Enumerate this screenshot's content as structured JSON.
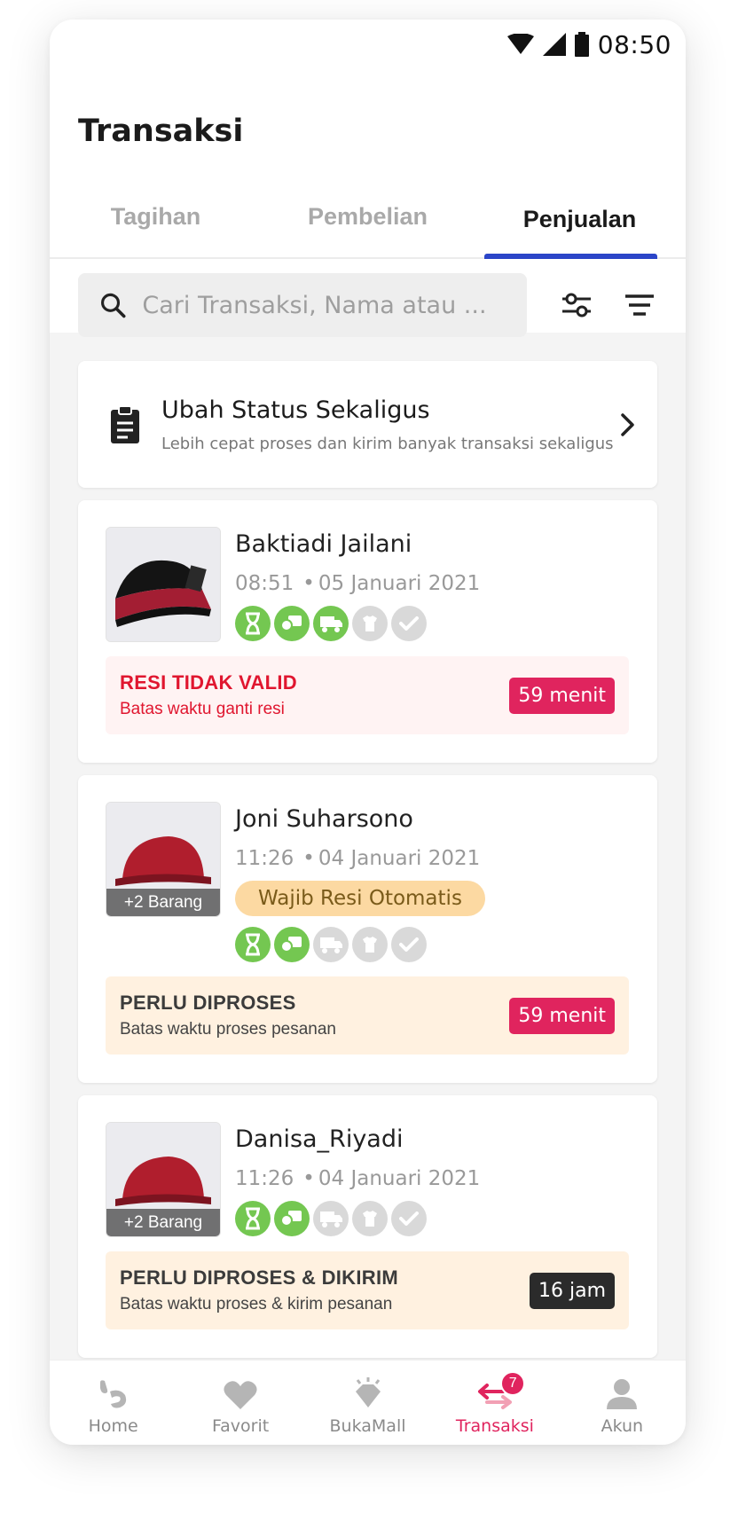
{
  "status_bar": {
    "time": "08:50"
  },
  "header": {
    "title": "Transaksi"
  },
  "tabs": [
    {
      "label": "Tagihan",
      "active": false
    },
    {
      "label": "Pembelian",
      "active": false
    },
    {
      "label": "Penjualan",
      "active": true
    }
  ],
  "search": {
    "placeholder": "Cari Transaksi, Nama atau ..."
  },
  "bulk_update": {
    "title": "Ubah Status Sekaligus",
    "subtitle": "Lebih cepat proses dan kirim banyak transaksi sekaligus"
  },
  "orders": [
    {
      "buyer": "Baktiadi Jailani",
      "time": "08:51",
      "date": "05 Januari 2021",
      "extra_items": "",
      "tag": "",
      "steps_done": 3,
      "alert": {
        "title": "RESI TIDAK VALID",
        "subtitle": "Batas waktu ganti resi",
        "timer": "59 menit",
        "tone": "red"
      }
    },
    {
      "buyer": "Joni Suharsono",
      "time": "11:26",
      "date": "04 Januari 2021",
      "extra_items": "+2 Barang",
      "tag": "Wajib Resi Otomatis",
      "steps_done": 2,
      "alert": {
        "title": "PERLU DIPROSES",
        "subtitle": "Batas waktu proses pesanan",
        "timer": "59 menit",
        "tone": "amber"
      }
    },
    {
      "buyer": "Danisa_Riyadi",
      "time": "11:26",
      "date": "04 Januari 2021",
      "extra_items": "+2 Barang",
      "tag": "",
      "steps_done": 2,
      "alert": {
        "title": "PERLU DIPROSES & DIKIRIM",
        "subtitle": "Batas waktu proses & kirim pesanan",
        "timer": "16 jam",
        "tone": "amber"
      }
    }
  ],
  "bottom_nav": [
    {
      "label": "Home",
      "icon": "home-icon",
      "active": false
    },
    {
      "label": "Favorit",
      "icon": "heart-icon",
      "active": false
    },
    {
      "label": "BukaMall",
      "icon": "diamond-icon",
      "active": false
    },
    {
      "label": "Transaksi",
      "icon": "transaction-icon",
      "active": true,
      "badge": "7"
    },
    {
      "label": "Akun",
      "icon": "user-icon",
      "active": false
    }
  ],
  "colors": {
    "accent": "#2b45c8",
    "brand": "#e0245e",
    "step_done": "#74c751",
    "step_todo": "#d9d9d9"
  }
}
